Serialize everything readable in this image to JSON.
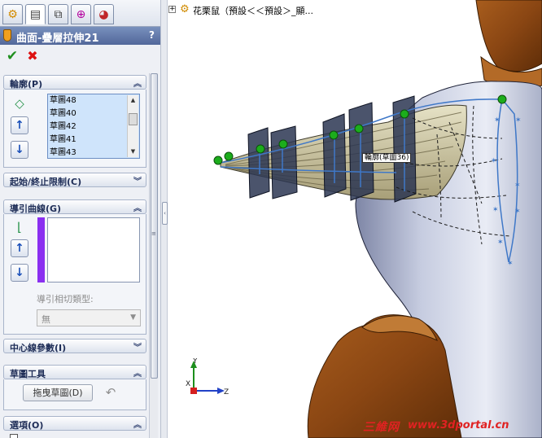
{
  "tabs": [
    {
      "icon": "feature-manager-icon"
    },
    {
      "icon": "property-manager-icon"
    },
    {
      "icon": "configuration-manager-icon"
    },
    {
      "icon": "dimxpert-icon"
    },
    {
      "icon": "display-manager-icon"
    }
  ],
  "feature": {
    "title": "曲面-疊層拉伸21",
    "help": "?",
    "ok_symbol": "✔",
    "cancel_symbol": "✖"
  },
  "groups": {
    "profiles": {
      "label": "輪廓(P)",
      "items": [
        "草圖48",
        "草圖40",
        "草圖42",
        "草圖41",
        "草圖43"
      ]
    },
    "constraints": {
      "label": "起始/終止限制(C)"
    },
    "guides": {
      "label": "導引曲線(G)",
      "tangent_label": "導引相切類型:",
      "tangent_value": "無"
    },
    "centerline": {
      "label": "中心線參數(I)"
    },
    "sketch_tools": {
      "label": "草圖工具",
      "drag_button": "拖曳草圖(D)"
    },
    "options": {
      "label": "選項(O)"
    }
  },
  "viewport": {
    "tree_path": "花栗鼠（預設＜＜預設＞_顯...",
    "profile_tooltip": "輪廓(草圖36)",
    "axes": {
      "x": "X",
      "y": "Y",
      "z": "Z"
    },
    "watermark_logo": "三維网",
    "watermark_url": "www.3dportal.cn"
  },
  "colors": {
    "guide_curve": "#8a2ff0",
    "body_shell": "#b9bfd4",
    "body_inner": "#8b4a16",
    "sketch_line": "#3f78c8",
    "sketch_point": "#1cad1c",
    "profile_plane": "#2c3652",
    "watermark": "#e02222"
  }
}
